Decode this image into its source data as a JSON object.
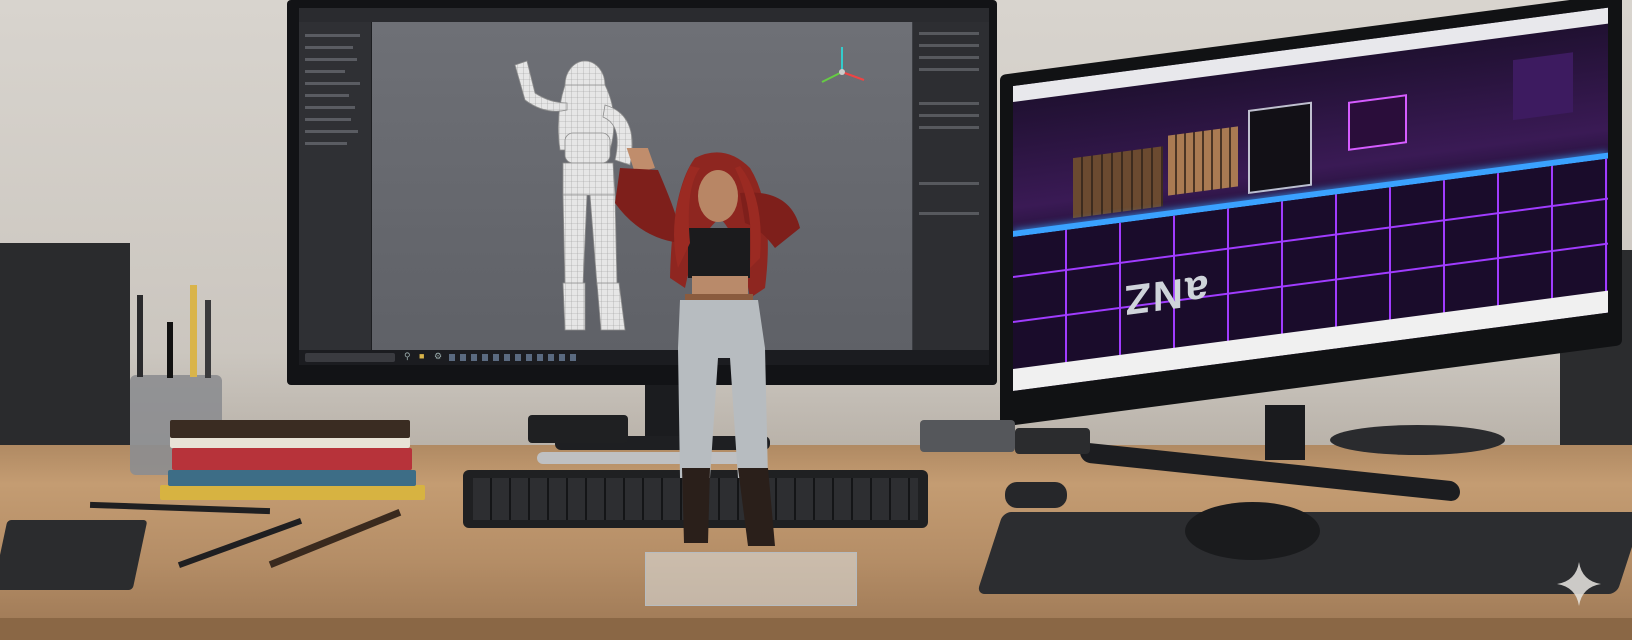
{
  "scene": {
    "description_colors": {
      "wall": "#cfcac4",
      "desk": "#b48d66",
      "screen_neon": "#c04cff",
      "figure_hair": "#9b2a22",
      "figure_top": "#7e1f1b"
    }
  },
  "left_monitor": {
    "app_icons": [
      "search-icon",
      "folder-icon",
      "gear-icon"
    ]
  },
  "right_monitor": {
    "floor_text": "aNZ"
  },
  "watermark": {
    "icon": "sparkle-icon"
  }
}
